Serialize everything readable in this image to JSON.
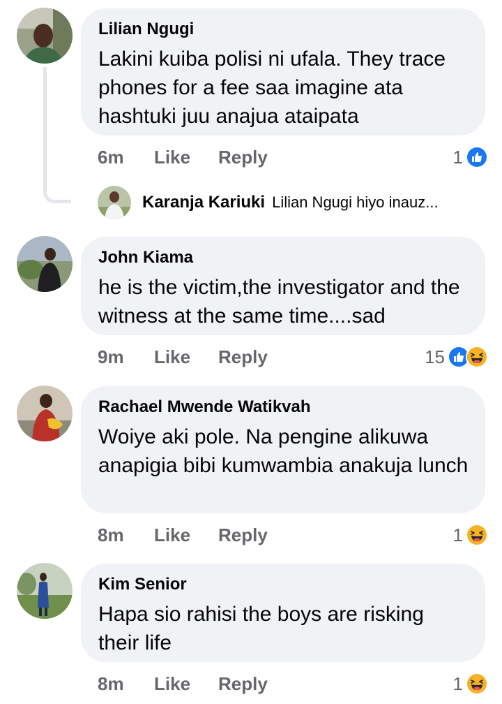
{
  "colors": {
    "bubble_bg": "#f0f2f5",
    "meta_text": "#65676b",
    "like_blue": "#1877f2",
    "haha_yellow": "#f7b125",
    "thread_line": "#e4e6eb"
  },
  "comments": [
    {
      "author": "Lilian Ngugi",
      "text": "Lakini kuiba polisi ni ufala. They trace phones for a fee saa imagine ata hashtuki juu anajua ataipata",
      "time": "6m",
      "like_label": "Like",
      "reply_label": "Reply",
      "reaction_count": "1",
      "reaction_icons": [
        "like-icon"
      ]
    },
    {
      "author": "John Kiama",
      "text": "he is the victim,the investigator and the witness at the same time....sad",
      "time": "9m",
      "like_label": "Like",
      "reply_label": "Reply",
      "reaction_count": "15",
      "reaction_icons": [
        "like-icon",
        "haha-icon"
      ]
    },
    {
      "author": "Rachael Mwende Watikvah",
      "text": "Woiye aki pole. Na pengine alikuwa anapigia bibi kumwambia anakuja lunch",
      "time": "8m",
      "like_label": "Like",
      "reply_label": "Reply",
      "reaction_count": "1",
      "reaction_icons": [
        "haha-icon"
      ]
    },
    {
      "author": "Kim Senior",
      "text": "Hapa sio rahisi the boys are risking their life",
      "time": "8m",
      "like_label": "Like",
      "reply_label": "Reply",
      "reaction_count": "1",
      "reaction_icons": [
        "haha-icon"
      ]
    }
  ],
  "reply_preview": {
    "author": "Karanja Kariuki",
    "snippet": "Lilian Ngugi hiyo  inauz..."
  }
}
